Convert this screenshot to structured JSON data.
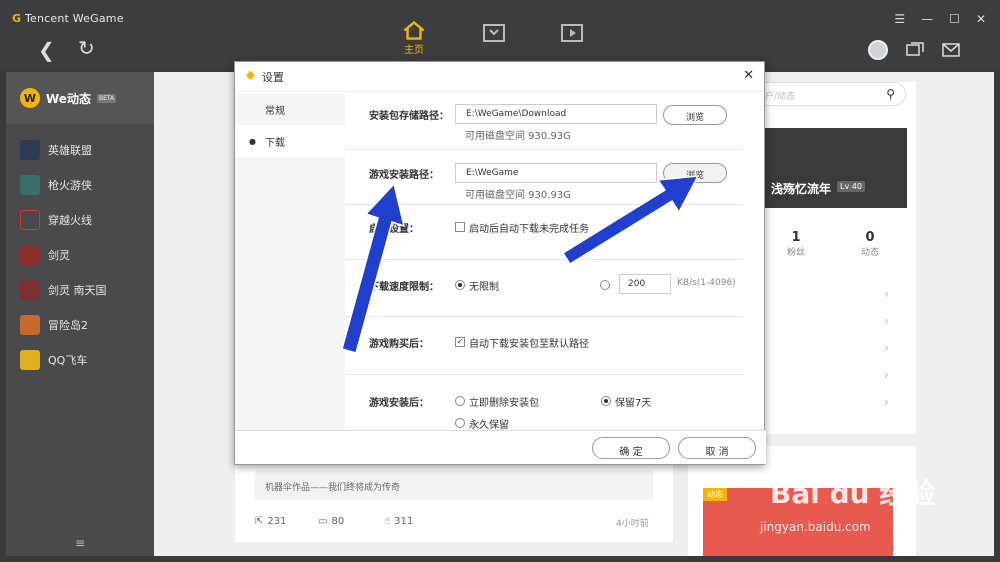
{
  "app": {
    "brand_prefix": "G",
    "brand": "Tencent WeGame"
  },
  "main_tabs": [
    {
      "label": "主页"
    }
  ],
  "sidebar": {
    "header": {
      "label": "We动态",
      "badge": "BETA"
    },
    "items": [
      {
        "label": "英雄联盟",
        "color": "#2d3b55"
      },
      {
        "label": "枪火游侠",
        "color": "#3a6e6a"
      },
      {
        "label": "穿越火线",
        "color": "#4a4a4a"
      },
      {
        "label": "剑灵",
        "color": "#8a2d2d"
      },
      {
        "label": "剑灵 南天国",
        "color": "#7a3030"
      },
      {
        "label": "冒险岛2",
        "color": "#c46a2a"
      },
      {
        "label": "QQ飞车",
        "color": "#e0b020"
      }
    ]
  },
  "search": {
    "placeholder": "户/动态"
  },
  "profile": {
    "name": "浅殇忆流年",
    "level": "Lv 40"
  },
  "stats": [
    {
      "value": "1",
      "label": "粉丝"
    },
    {
      "value": "0",
      "label": "动态"
    }
  ],
  "post": {
    "caption": "机器伞作品——我们终将成为传奇",
    "shares": "231",
    "comments": "80",
    "likes": "311",
    "time": "4小时前"
  },
  "ad": {
    "badge": "动态"
  },
  "watermark": {
    "line1": "Bai du 经验",
    "line2": "jingyan.baidu.com"
  },
  "dialog": {
    "title": "设置",
    "tabs": [
      {
        "label": "常规"
      },
      {
        "label": "下载"
      }
    ],
    "install_package_path": {
      "label": "安装包存储路径：",
      "value": "E:\\WeGame\\Download",
      "space": "可用磁盘空间 930.93G",
      "browse": "浏览"
    },
    "game_install_path": {
      "label": "游戏安装路径：",
      "value": "E:\\WeGame",
      "space": "可用磁盘空间 930.93G",
      "browse": "浏览"
    },
    "on_start": {
      "label": "启动设置：",
      "option": "启动后自动下载未完成任务"
    },
    "speed_limit": {
      "label": "下载速度限制：",
      "option_unlimited": "无限制",
      "value": "200",
      "unit": "KB/s(1-4096)"
    },
    "after_purchase": {
      "label": "游戏购买后：",
      "option": "自动下载安装包至默认路径"
    },
    "after_install": {
      "label": "游戏安装后：",
      "option_delete": "立即删除安装包",
      "option_keep7": "保留7天",
      "option_forever": "永久保留"
    },
    "ok": "确 定",
    "cancel": "取 消"
  },
  "colors": {
    "accent": "#f4b400",
    "arrow": "#1f3fcc"
  }
}
